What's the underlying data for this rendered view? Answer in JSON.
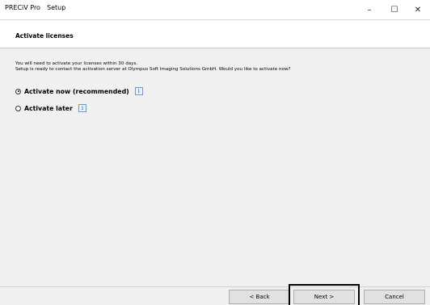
{
  "window": {
    "app_name": "PRECiV Pro",
    "page_name": "Setup",
    "minimize_glyph": "–",
    "maximize_glyph": "☐",
    "close_glyph": "✕"
  },
  "header": {
    "title": "Activate licenses"
  },
  "intro": {
    "line1": "You will need to activate your licenses within 30 days.",
    "line2": "Setup is ready to contact the activation server at Olympus Soft Imaging Solutions GmbH. Would you like to activate now?"
  },
  "options": [
    {
      "label": "Activate now (recommended)",
      "selected": true,
      "info_icon": "info-icon"
    },
    {
      "label": "Activate later",
      "selected": false,
      "info_icon": "info-icon"
    }
  ],
  "buttons": {
    "back": "< Back",
    "next": "Next >",
    "cancel": "Cancel"
  },
  "colors": {
    "window_bg": "#f0f0f0",
    "header_bg": "#ffffff",
    "info_icon": "#2b58b3"
  }
}
